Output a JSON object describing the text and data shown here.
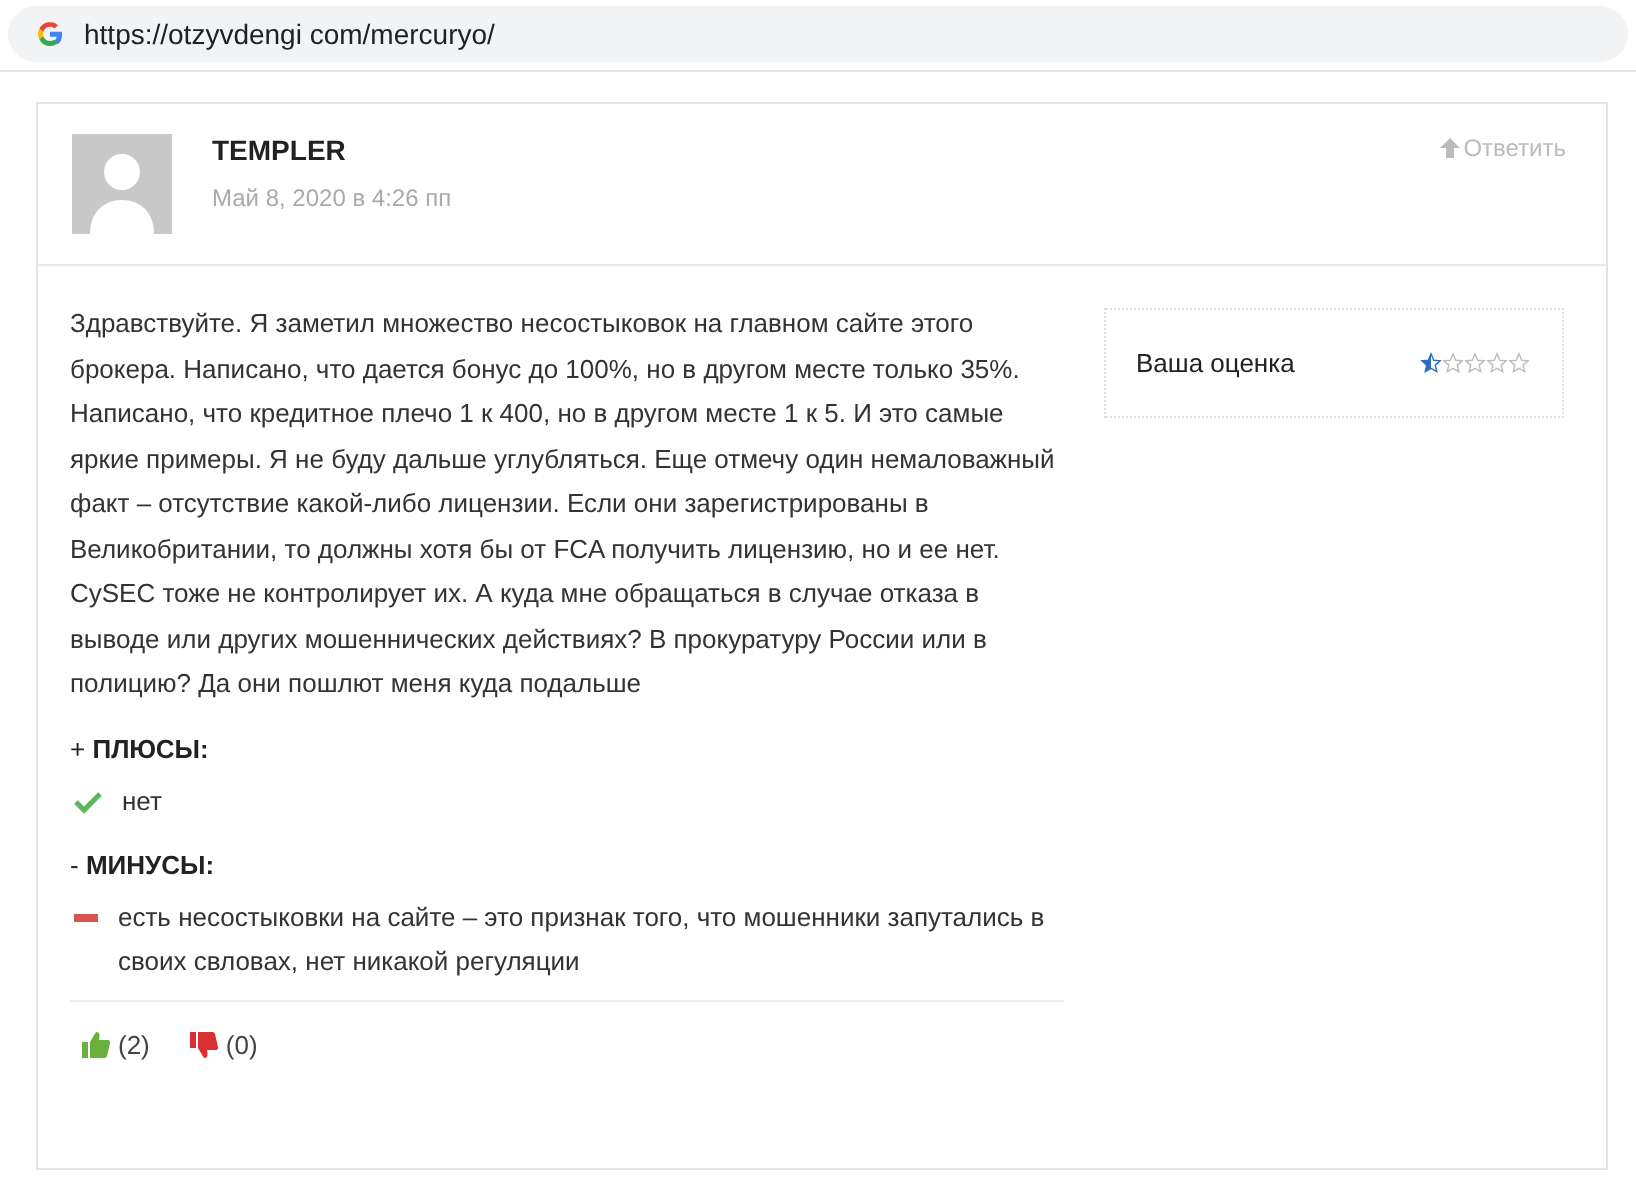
{
  "address_bar": {
    "url": "https://otzyvdengi com/mercuryo/"
  },
  "comment": {
    "author": "TEMPLER",
    "date": "Май 8, 2020 в 4:26 пп",
    "reply": "Ответить",
    "text": "Здравствуйте. Я заметил множество несостыковок на главном сайте этого брокера. Написано, что дается бонус до 100%, но в другом месте только 35%. Написано, что кредитное плечо 1 к 400, но в другом месте 1 к 5. И это самые яркие примеры. Я не буду дальше углубляться. Еще отмечу один немаловажный факт – отсутствие какой-либо лицензии. Если они зарегистрированы в Великобритании, то должны хотя бы от FCA получить лицензию, но и ее нет. CySEC тоже не контролирует их. А куда мне обращаться в случае отказа в выводе или других мошеннических действиях? В прокуратуру России или в полицию? Да они пошлют меня куда подальше",
    "rating": {
      "label": "Ваша оценка",
      "stars": 0.5
    },
    "sections": [
      {
        "kind": "pros",
        "prefix": "+",
        "title": "ПЛЮСЫ:",
        "items": [
          "нет"
        ]
      },
      {
        "kind": "cons",
        "prefix": "-",
        "title": "МИНУСЫ:",
        "items": [
          "есть несостыковки на сайте – это признак того, что мошенники запутались в своих свловах, нет никакой регуляции"
        ]
      }
    ],
    "votes": [
      {
        "kind": "up",
        "count": "(2)"
      },
      {
        "kind": "down",
        "count": "(0)"
      }
    ]
  }
}
